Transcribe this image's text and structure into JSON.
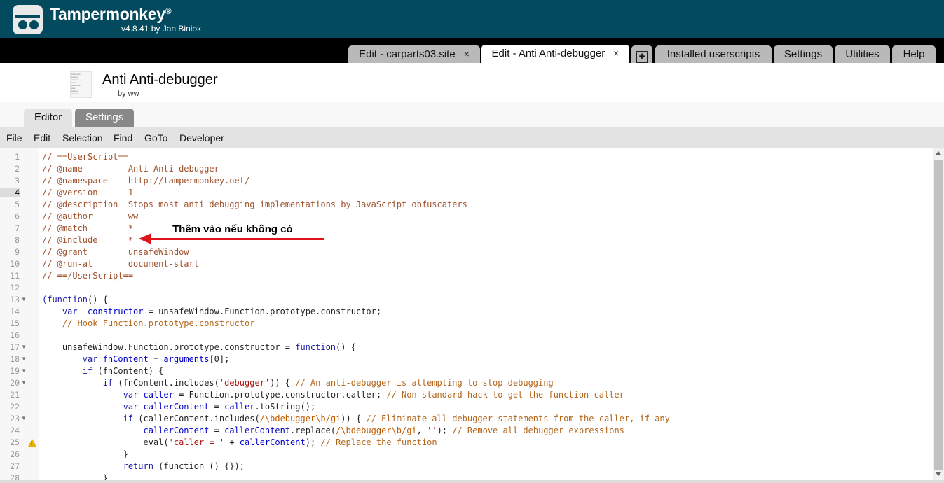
{
  "app": {
    "name": "Tampermonkey",
    "reg": "®",
    "version": "v4.8.41 by Jan Biniok"
  },
  "tabs": [
    {
      "label": "Edit - carparts03.site",
      "close": "×"
    },
    {
      "label": "Edit - Anti Anti-debugger",
      "close": "×"
    },
    {
      "label": "+"
    },
    {
      "label": "Installed userscripts"
    },
    {
      "label": "Settings"
    },
    {
      "label": "Utilities"
    },
    {
      "label": "Help"
    }
  ],
  "script": {
    "title": "Anti Anti-debugger",
    "author": "by ww"
  },
  "subtabs": [
    "Editor",
    "Settings"
  ],
  "menu": [
    "File",
    "Edit",
    "Selection",
    "Find",
    "GoTo",
    "Developer"
  ],
  "annotation": "Thêm vào nếu không có",
  "line_numbers": [
    "1",
    "2",
    "3",
    "4",
    "5",
    "6",
    "7",
    "8",
    "9",
    "10",
    "11",
    "12",
    "13",
    "14",
    "15",
    "16",
    "17",
    "18",
    "19",
    "20",
    "21",
    "22",
    "23",
    "24",
    "25",
    "26",
    "27",
    "28"
  ],
  "code": {
    "l1": "// ==UserScript==",
    "l2": "// @name         Anti Anti-debugger",
    "l3": "// @namespace    http://tampermonkey.net/",
    "l4": "// @version      1",
    "l5": "// @description  Stops most anti debugging implementations by JavaScript obfuscaters",
    "l6": "// @author       ww",
    "l7": "// @match        *",
    "l8": "// @include      *",
    "l9": "// @grant        unsafeWindow",
    "l10": "// @run-at       document-start",
    "l11": "// ==/UserScript==",
    "l13a": "(function",
    "l13b": "() {",
    "l14a": "    var",
    "l14b": " _constructor",
    "l14c": " = unsafeWindow.Function.prototype.constructor;",
    "l15": "    // Hook Function.prototype.constructor",
    "l17a": "    unsafeWindow.Function.prototype.constructor = ",
    "l17b": "function",
    "l17c": "() {",
    "l18a": "        var",
    "l18b": " fnContent",
    "l18c": " = ",
    "l18d": "arguments",
    "l18e": "[0];",
    "l19a": "        if",
    "l19b": " (fnContent) {",
    "l20a": "            if",
    "l20b": " (fnContent.includes(",
    "l20c": "'debugger'",
    "l20d": ")) { ",
    "l20e": "// An anti-debugger is attempting to stop debugging",
    "l21a": "                var",
    "l21b": " caller",
    "l21c": " = Function.prototype.constructor.caller; ",
    "l21d": "// Non-standard hack to get the function caller",
    "l22a": "                var",
    "l22b": " callerContent",
    "l22c": " = ",
    "l22d": "caller",
    "l22e": ".toString();",
    "l23a": "                if",
    "l23b": " (callerContent.includes(",
    "l23c": "/\\bdebugger\\b/gi",
    "l23d": ")) { ",
    "l23e": "// Eliminate all debugger statements from the caller, if any",
    "l24a": "                    callerContent",
    "l24b": " = ",
    "l24c": "callerContent",
    "l24d": ".replace(",
    "l24e": "/\\bdebugger\\b/gi",
    "l24f": ", ",
    "l24g": "''",
    "l24h": "); ",
    "l24i": "// Remove all debugger expressions",
    "l25a": "                    eval(",
    "l25b": "'caller = '",
    "l25c": " + ",
    "l25d": "callerContent",
    "l25e": "); ",
    "l25f": "// Replace the function",
    "l26": "                }",
    "l27a": "                return",
    "l27b": " (function () {});",
    "l28": "            }"
  }
}
